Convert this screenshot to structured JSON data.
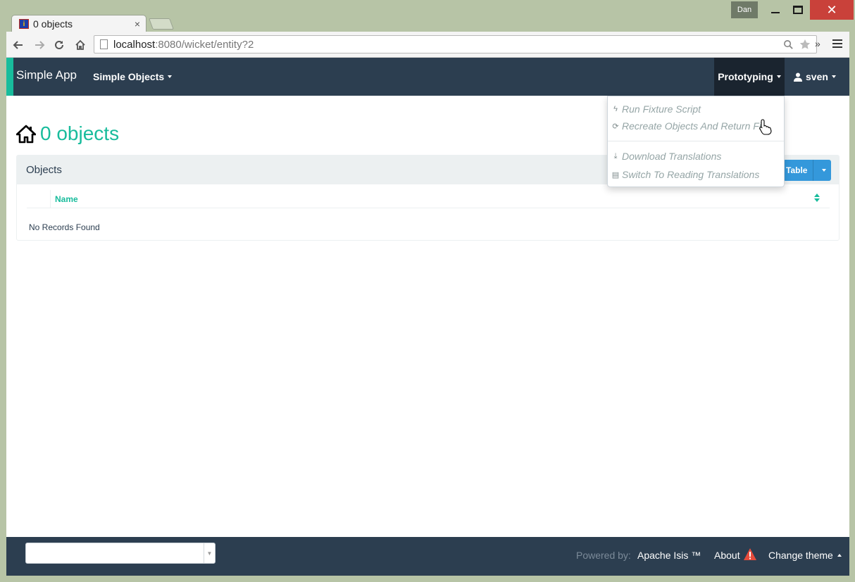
{
  "window": {
    "user": "Dan",
    "tab_title": "0 objects",
    "tab_close": "×",
    "close_glyph": "✕"
  },
  "browser": {
    "url_host": "localhost",
    "url_rest": ":8080/wicket/entity?2",
    "more": "»"
  },
  "navbar": {
    "brand": "Simple App",
    "menu": "Simple Objects",
    "prototyping": "Prototyping",
    "user": "sven"
  },
  "page": {
    "title": "0 objects"
  },
  "panel": {
    "heading": "Objects",
    "view_button": "Table",
    "column_name": "Name",
    "empty": "No Records Found"
  },
  "dropdown": {
    "items": [
      {
        "label": "Run Fixture Script",
        "icon": "bolt-icon"
      },
      {
        "label": "Recreate Objects And Return Fi",
        "icon": "refresh-icon"
      },
      {
        "label": "Download Translations",
        "icon": "download-icon"
      },
      {
        "label": "Switch To Reading Translations",
        "icon": "book-icon"
      }
    ]
  },
  "footer": {
    "powered_by": "Powered by:",
    "isis": "Apache Isis ™",
    "about": "About",
    "change_theme": "Change theme"
  },
  "colors": {
    "navbar": "#2c3e50",
    "accent": "#18bc9c",
    "button": "#3498db",
    "warning": "#e74c3c"
  }
}
